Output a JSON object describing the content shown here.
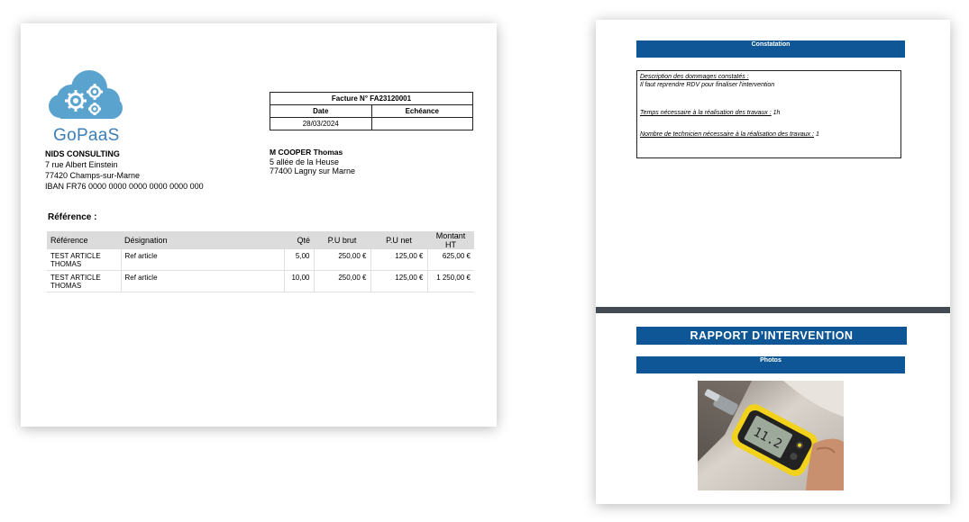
{
  "invoice": {
    "logo_text": "GoPaaS",
    "company": {
      "name": "NIDS CONSULTING",
      "street": "7 rue Albert Einstein",
      "city": "77420 Champs-sur-Marne",
      "iban": "IBAN FR76 0000 0000 0000 0000 0000 000"
    },
    "header_box": {
      "title": "Facture N° FA23120001",
      "date_label": "Date",
      "due_label": "Echéance",
      "date_value": "28/03/2024",
      "due_value": ""
    },
    "client": {
      "name": "M COOPER Thomas",
      "street": "5 allée de la Heuse",
      "city": "77400 Lagny sur Marne"
    },
    "reference_label": "Référence :",
    "table": {
      "headers": [
        "Référence",
        "Désignation",
        "Qté",
        "P.U brut",
        "P.U net",
        "Montant  HT"
      ],
      "rows": [
        [
          "TEST ARTICLE THOMAS",
          "Ref article",
          "5,00",
          "250,00 €",
          "125,00 €",
          "625,00 €"
        ],
        [
          "TEST ARTICLE THOMAS",
          "Ref article",
          "10,00",
          "250,00 €",
          "125,00 €",
          "1 250,00 €"
        ]
      ]
    }
  },
  "report": {
    "constat_band": "Constatation",
    "desc_label": "Description des dommages constatés :",
    "desc_text": "Il faut reprendre RDV pour finaliser l'intervention",
    "time_label": "Temps nécessaire à la réalisation des travaux :",
    "time_value": " 1h",
    "tech_label": "Nombre de technicien nécessaire à la réalisation des travaux :",
    "tech_value": " 1",
    "title_band": "RAPPORT D’INTERVENTION",
    "photos_band": "Photos",
    "photo_reading": "11.2"
  },
  "colors": {
    "band_blue": "#0e5696",
    "logo_blue": "#5ba3cf"
  }
}
